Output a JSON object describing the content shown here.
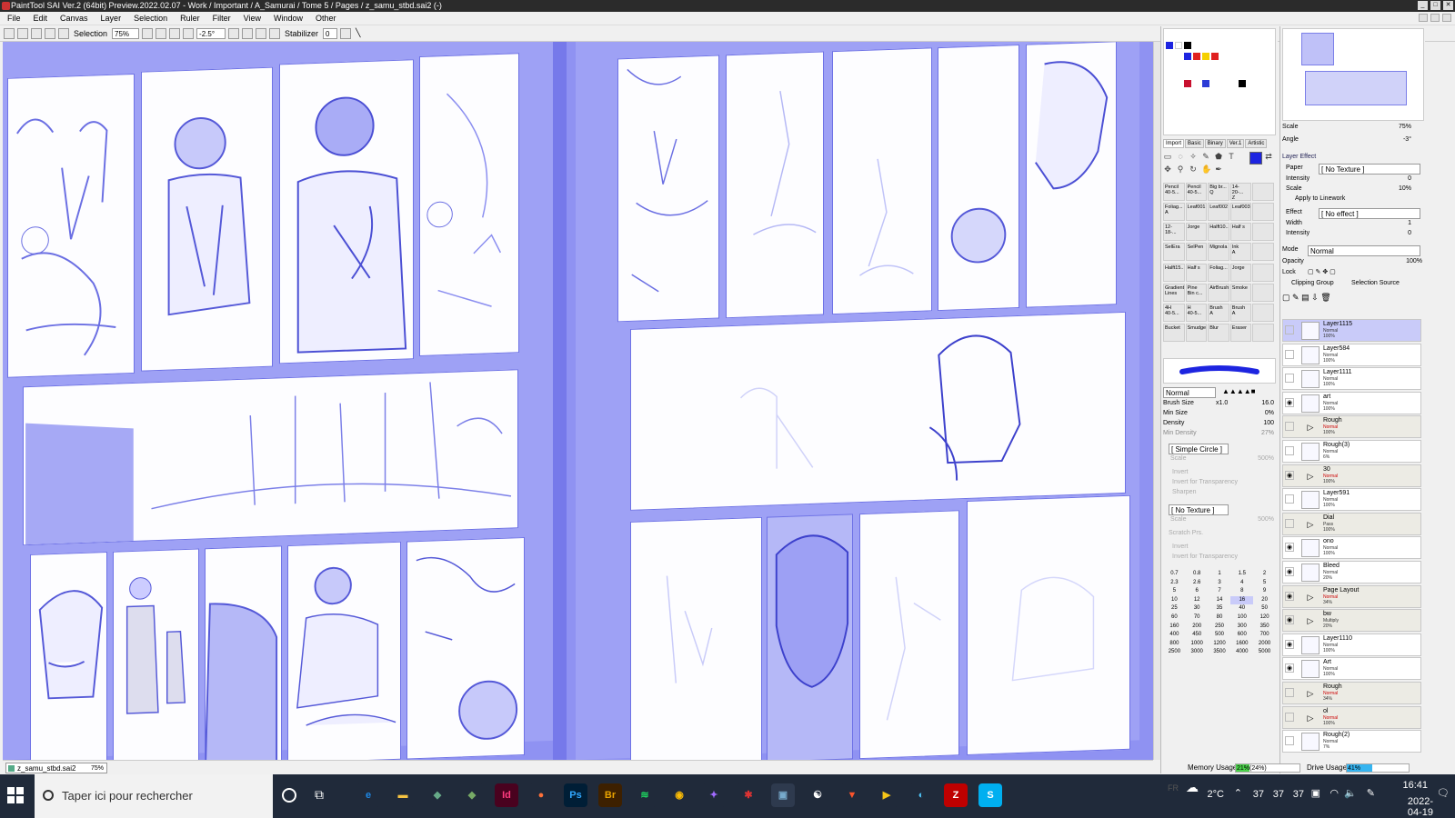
{
  "window": {
    "title": "PaintTool SAI Ver.2 (64bit) Preview.2022.02.07 - Work / Important / A_Samurai / Tome 5 / Pages / z_samu_stbd.sai2 (-)"
  },
  "menu": [
    "File",
    "Edit",
    "Canvas",
    "Layer",
    "Selection",
    "Ruler",
    "Filter",
    "View",
    "Window",
    "Other"
  ],
  "toolbar": {
    "selection_label": "Selection",
    "zoom": "75%",
    "angle": "-2.5°",
    "stabilizer_label": "Stabilizer",
    "stabilizer_value": "0"
  },
  "document_tab": {
    "name": "z_samu_stbd.sai2",
    "zoom": "75%"
  },
  "tool_tabs": [
    "Import",
    "Basic",
    "Binary",
    "Ver.1",
    "Artistic"
  ],
  "brushes": [
    {
      "name": "Pencil",
      "size": "40-5..."
    },
    {
      "name": "Pencil",
      "size": "40-5..."
    },
    {
      "name": "Big br...",
      "size": "Q"
    },
    {
      "name": "14-20-...",
      "size": "Z"
    },
    {
      "name": "",
      "size": ""
    },
    {
      "name": "Foliag...",
      "size": "A"
    },
    {
      "name": "Leaf001",
      "size": ""
    },
    {
      "name": "Leaf002",
      "size": ""
    },
    {
      "name": "Leaf003",
      "size": ""
    },
    {
      "name": "",
      "size": ""
    },
    {
      "name": "12-18-...",
      "size": ""
    },
    {
      "name": "Jorge",
      "size": ""
    },
    {
      "name": "Halft10...",
      "size": ""
    },
    {
      "name": "Half s",
      "size": ""
    },
    {
      "name": "",
      "size": ""
    },
    {
      "name": "SelEra",
      "size": ""
    },
    {
      "name": "SelPen",
      "size": ""
    },
    {
      "name": "Mignola",
      "size": ""
    },
    {
      "name": "Ink",
      "size": "A"
    },
    {
      "name": "",
      "size": ""
    },
    {
      "name": "Halft15...",
      "size": ""
    },
    {
      "name": "Half s",
      "size": ""
    },
    {
      "name": "Foliag...",
      "size": ""
    },
    {
      "name": "Jorge",
      "size": ""
    },
    {
      "name": "",
      "size": ""
    },
    {
      "name": "Gradient",
      "size": "Lines"
    },
    {
      "name": "Pine",
      "size": "Bin c..."
    },
    {
      "name": "AirBrush",
      "size": ""
    },
    {
      "name": "Smoke",
      "size": ""
    },
    {
      "name": "",
      "size": ""
    },
    {
      "name": "4H",
      "size": "40-5..."
    },
    {
      "name": "H",
      "size": "40-5..."
    },
    {
      "name": "Brush",
      "size": "A"
    },
    {
      "name": "Brush",
      "size": "A"
    },
    {
      "name": "",
      "size": ""
    },
    {
      "name": "Bucket",
      "size": ""
    },
    {
      "name": "Smudge",
      "size": ""
    },
    {
      "name": "Blur",
      "size": ""
    },
    {
      "name": "Eraser",
      "size": ""
    },
    {
      "name": "",
      "size": ""
    }
  ],
  "brush_settings": {
    "blend_mode": "Normal",
    "brush_size_label": "Brush Size",
    "brush_size_mult": "x1.0",
    "brush_size": "16.0",
    "min_size_label": "Min Size",
    "min_size": "0%",
    "density_label": "Density",
    "density": "100",
    "min_density_label": "Min Density",
    "min_density": "27%",
    "shape": "[ Simple Circle ]",
    "scale_label": "Scale",
    "scale": "500%",
    "invert": "Invert",
    "invert_transparency": "Invert for Transparency",
    "sharpen": "Sharpen",
    "texture": "[ No Texture ]",
    "texture_scale": "500%",
    "scratch_prs": "Scratch Prs.",
    "invert2": "Invert",
    "invert_transparency2": "Invert for Transparency"
  },
  "size_presets": [
    "0.7",
    "0.8",
    "1",
    "1.5",
    "2",
    "2.3",
    "2.6",
    "3",
    "4",
    "5",
    "5",
    "6",
    "7",
    "8",
    "9",
    "10",
    "12",
    "14",
    "16",
    "20",
    "25",
    "30",
    "35",
    "40",
    "50",
    "60",
    "70",
    "80",
    "100",
    "120",
    "160",
    "200",
    "250",
    "300",
    "350",
    "400",
    "450",
    "500",
    "600",
    "700",
    "800",
    "1000",
    "1200",
    "1600",
    "2000",
    "2500",
    "3000",
    "3500",
    "4000",
    "5000"
  ],
  "selected_size": "16",
  "navigator": {
    "scale_label": "Scale",
    "scale": "75%",
    "angle_label": "Angle",
    "angle": "-3°"
  },
  "layer_effect": {
    "header": "Layer Effect",
    "paper_label": "Paper",
    "paper": "[ No Texture ]",
    "intensity_label": "Intensity",
    "intensity": "0",
    "scale_label": "Scale",
    "scale": "10%",
    "apply_linework": "Apply to Linework",
    "effect_label": "Effect",
    "effect": "[ No effect ]",
    "width_label": "Width",
    "width": "1",
    "intensity2_label": "Intensity",
    "intensity2": "0"
  },
  "layer_props": {
    "mode_label": "Mode",
    "mode": "Normal",
    "opacity_label": "Opacity",
    "opacity": "100%",
    "lock_label": "Lock",
    "clipping_group": "Clipping Group",
    "selection_source": "Selection Source"
  },
  "layers": [
    {
      "name": "Layer1115",
      "mode": "Normal",
      "opacity": "100%",
      "visible": false,
      "selected": true,
      "folder": false
    },
    {
      "name": "Layer584",
      "mode": "Normal",
      "opacity": "100%",
      "visible": false,
      "selected": false,
      "folder": false
    },
    {
      "name": "Layer1111",
      "mode": "Normal",
      "opacity": "100%",
      "visible": false,
      "selected": false,
      "folder": false
    },
    {
      "name": "art",
      "mode": "Normal",
      "opacity": "100%",
      "visible": true,
      "selected": false,
      "folder": false
    },
    {
      "name": "Rough",
      "mode": "Normal",
      "opacity": "100%",
      "visible": false,
      "selected": false,
      "folder": true
    },
    {
      "name": "Rough(3)",
      "mode": "Normal",
      "opacity": "6%",
      "visible": false,
      "selected": false,
      "folder": false
    },
    {
      "name": "30",
      "mode": "Normal",
      "opacity": "100%",
      "visible": true,
      "selected": false,
      "folder": true
    },
    {
      "name": "Layer591",
      "mode": "Normal",
      "opacity": "100%",
      "visible": false,
      "selected": false,
      "folder": false
    },
    {
      "name": "Dial",
      "mode": "Pass",
      "opacity": "100%",
      "visible": false,
      "selected": false,
      "folder": true
    },
    {
      "name": "ono",
      "mode": "Normal",
      "opacity": "100%",
      "visible": true,
      "selected": false,
      "folder": false
    },
    {
      "name": "Bleed",
      "mode": "Normal",
      "opacity": "20%",
      "visible": true,
      "selected": false,
      "folder": false
    },
    {
      "name": "Page Layout",
      "mode": "Normal",
      "opacity": "34%",
      "visible": true,
      "selected": false,
      "folder": true
    },
    {
      "name": "bw",
      "mode": "Multiply",
      "opacity": "20%",
      "visible": true,
      "selected": false,
      "folder": true
    },
    {
      "name": "Layer1110",
      "mode": "Normal",
      "opacity": "100%",
      "visible": true,
      "selected": false,
      "folder": false
    },
    {
      "name": "Art",
      "mode": "Normal",
      "opacity": "100%",
      "visible": true,
      "selected": false,
      "folder": false
    },
    {
      "name": "Rough",
      "mode": "Normal",
      "opacity": "34%",
      "visible": false,
      "selected": false,
      "folder": true
    },
    {
      "name": "ol",
      "mode": "Normal",
      "opacity": "100%",
      "visible": false,
      "selected": false,
      "folder": true
    },
    {
      "name": "Rough(2)",
      "mode": "Normal",
      "opacity": "7%",
      "visible": false,
      "selected": false,
      "folder": false
    }
  ],
  "status": {
    "memory_label": "Memory Usage",
    "memory": "21%(24%)",
    "memory_fraction": 0.21,
    "drive_label": "Drive Usage",
    "drive": "41%",
    "drive_fraction": 0.41
  },
  "taskbar": {
    "search_placeholder": "Taper ici pour rechercher",
    "weather": "2°C",
    "tray_numbers": [
      "37",
      "37",
      "37"
    ],
    "lang": "FR",
    "time": "16:41",
    "date": "2022-04-19",
    "apps": [
      {
        "name": "edge-icon",
        "glyph": "e",
        "color": "#1e88e5",
        "bg": "#202a3a"
      },
      {
        "name": "explorer-icon",
        "glyph": "▬",
        "color": "#f6c342",
        "bg": "#202a3a"
      },
      {
        "name": "app-icon-3",
        "glyph": "◆",
        "color": "#6a8",
        "bg": "#202a3a"
      },
      {
        "name": "app-icon-4",
        "glyph": "◆",
        "color": "#7a6",
        "bg": "#202a3a"
      },
      {
        "name": "indesign-icon",
        "glyph": "Id",
        "color": "#ff3b7f",
        "bg": "#49021f"
      },
      {
        "name": "firefox-icon",
        "glyph": "●",
        "color": "#ff7139",
        "bg": "#202a3a"
      },
      {
        "name": "photoshop-icon",
        "glyph": "Ps",
        "color": "#31a8ff",
        "bg": "#001e36"
      },
      {
        "name": "bridge-icon",
        "glyph": "Br",
        "color": "#e8a200",
        "bg": "#3d2000"
      },
      {
        "name": "spotify-icon",
        "glyph": "≋",
        "color": "#1ed760",
        "bg": "#202a3a"
      },
      {
        "name": "chrome-icon",
        "glyph": "◉",
        "color": "#fbbc05",
        "bg": "#202a3a"
      },
      {
        "name": "messenger-icon",
        "glyph": "✦",
        "color": "#a16bff",
        "bg": "#202a3a"
      },
      {
        "name": "app-icon-12",
        "glyph": "✱",
        "color": "#d33",
        "bg": "#202a3a"
      },
      {
        "name": "sai-icon",
        "glyph": "▣",
        "color": "#7ac",
        "bg": "#2e3a4e"
      },
      {
        "name": "app-icon-14",
        "glyph": "☯",
        "color": "#fff",
        "bg": "#202a3a"
      },
      {
        "name": "brave-icon",
        "glyph": "▼",
        "color": "#fb542b",
        "bg": "#202a3a"
      },
      {
        "name": "app-icon-16",
        "glyph": "▶",
        "color": "#f5c518",
        "bg": "#202a3a"
      },
      {
        "name": "app-icon-17",
        "glyph": "◐",
        "color": "#4fc3f7",
        "bg": "#202a3a"
      },
      {
        "name": "filezilla-icon",
        "glyph": "Z",
        "color": "#fff",
        "bg": "#bf0000"
      },
      {
        "name": "skype-icon",
        "glyph": "S",
        "color": "#fff",
        "bg": "#00aff0"
      }
    ]
  }
}
